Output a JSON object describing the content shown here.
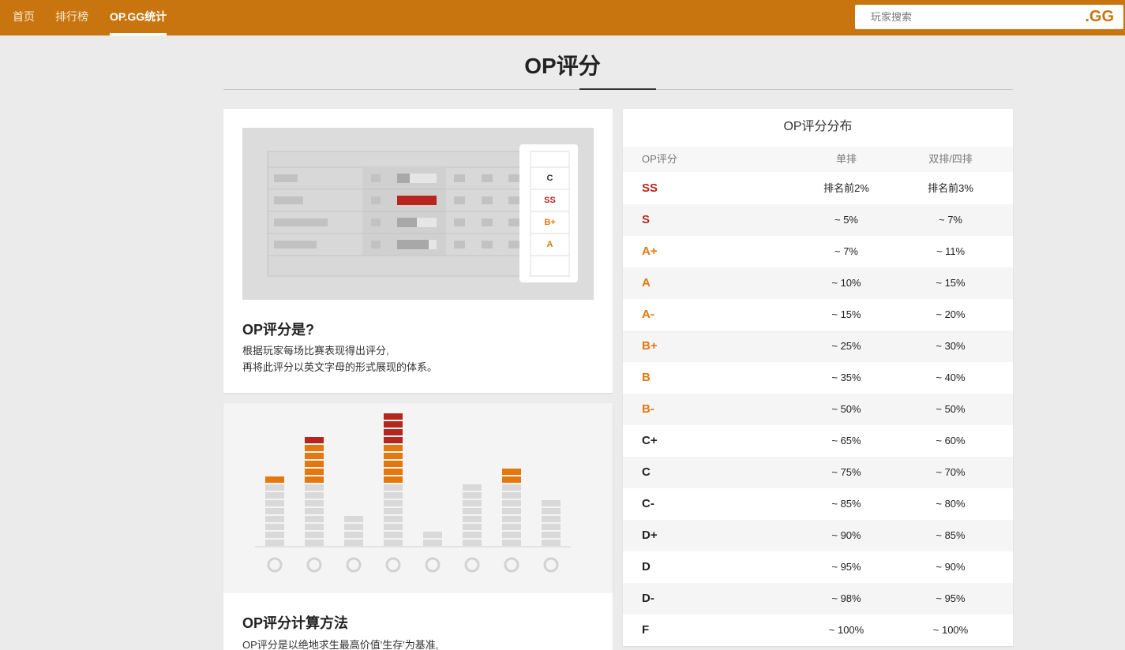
{
  "nav": {
    "items": [
      "首页",
      "排行榜",
      "OP.GG统计"
    ],
    "active": "OP.GG统计"
  },
  "search": {
    "placeholder": "玩家搜索",
    "logo": ".GG"
  },
  "page": {
    "title": "OP评分"
  },
  "card1": {
    "heading": "OP评分是?",
    "line1": "根据玩家每场比赛表现得出评分,",
    "line2": "再将此评分以英文字母的形式展现的体系。",
    "illustration_grades": [
      "C",
      "SS",
      "B+",
      "A"
    ]
  },
  "card2": {
    "heading": "OP评分计算方法",
    "line1": "OP评分是以绝地求生最高价值'生存'为基准,"
  },
  "distribution": {
    "title": "OP评分分布",
    "headers": [
      "OP评分",
      "单排",
      "双排/四排"
    ],
    "rows": [
      {
        "grade": "SS",
        "solo": "排名前2%",
        "squad": "排名前3%"
      },
      {
        "grade": "S",
        "solo": "~ 5%",
        "squad": "~ 7%"
      },
      {
        "grade": "A+",
        "solo": "~ 7%",
        "squad": "~ 11%"
      },
      {
        "grade": "A",
        "solo": "~ 10%",
        "squad": "~ 15%"
      },
      {
        "grade": "A-",
        "solo": "~ 15%",
        "squad": "~ 20%"
      },
      {
        "grade": "B+",
        "solo": "~ 25%",
        "squad": "~ 30%"
      },
      {
        "grade": "B",
        "solo": "~ 35%",
        "squad": "~ 40%"
      },
      {
        "grade": "B-",
        "solo": "~ 50%",
        "squad": "~ 50%"
      },
      {
        "grade": "C+",
        "solo": "~ 65%",
        "squad": "~ 60%"
      },
      {
        "grade": "C",
        "solo": "~ 75%",
        "squad": "~ 70%"
      },
      {
        "grade": "C-",
        "solo": "~ 85%",
        "squad": "~ 80%"
      },
      {
        "grade": "D+",
        "solo": "~ 90%",
        "squad": "~ 85%"
      },
      {
        "grade": "D",
        "solo": "~ 95%",
        "squad": "~ 90%"
      },
      {
        "grade": "D-",
        "solo": "~ 98%",
        "squad": "~ 95%"
      },
      {
        "grade": "F",
        "solo": "~ 100%",
        "squad": "~ 100%"
      }
    ]
  },
  "colors": {
    "brand": "#c8750f",
    "grade_red": "#b8251e",
    "grade_orange": "#e3780d",
    "bar_gray": "#d9d9d9"
  }
}
